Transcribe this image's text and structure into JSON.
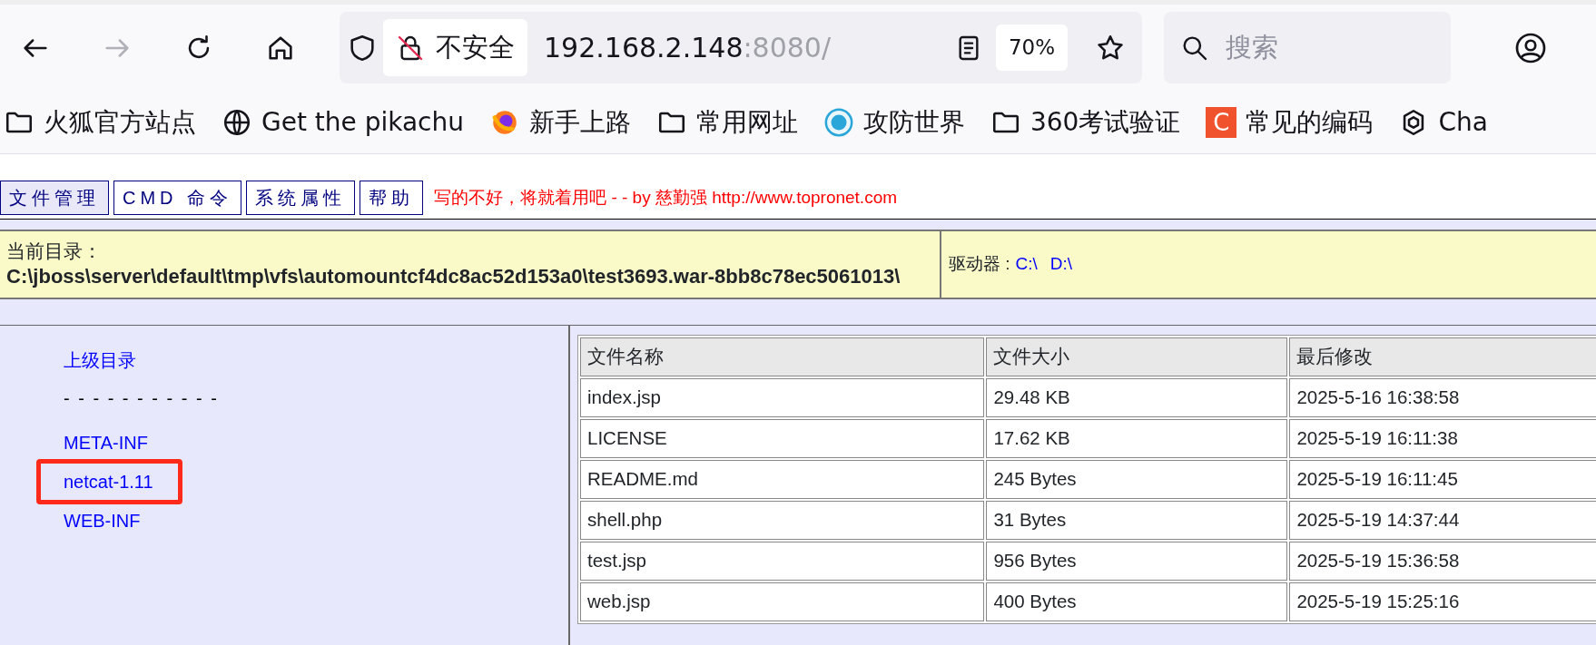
{
  "browser": {
    "forward_disabled": true,
    "security_label": "不安全",
    "host": "192.168.2.148",
    "port_path": ":8080/",
    "zoom": "70%",
    "search": {
      "placeholder": "搜索"
    }
  },
  "bookmarks": [
    {
      "kind": "folder",
      "label": "火狐官方站点"
    },
    {
      "kind": "globe",
      "label": "Get the pikachu"
    },
    {
      "kind": "fox",
      "label": "新手上路"
    },
    {
      "kind": "folder",
      "label": "常用网址"
    },
    {
      "kind": "seal",
      "label": "攻防世界"
    },
    {
      "kind": "folder",
      "label": "360考试验证"
    },
    {
      "kind": "letter",
      "icon_text": "C",
      "color": "#f0522d",
      "label": "常见的编码"
    },
    {
      "kind": "knot",
      "label": "Cha"
    }
  ],
  "tabs": [
    {
      "label": "文件管理",
      "selected": true
    },
    {
      "label": "CMD 命令",
      "selected": false
    },
    {
      "label": "系统属性",
      "selected": false
    },
    {
      "label": "帮助",
      "selected": false
    }
  ],
  "notice": "写的不好，将就着用吧 - - by 慈勤强 http://www.topronet.com",
  "current_dir": {
    "label": "当前目录：",
    "path": "C:\\jboss\\server\\default\\tmp\\vfs\\automountcf4dc8ac52d153a0\\test3693.war-8bb8c78ec5061013\\"
  },
  "drives": {
    "label": "驱动器 :",
    "items": [
      "C:\\",
      "D:\\"
    ]
  },
  "dirs": [
    {
      "kind": "link",
      "label": "上级目录",
      "highlighted": false
    },
    {
      "kind": "separator",
      "label": "- - - - - - - - - - -"
    },
    {
      "kind": "link",
      "label": "META-INF",
      "highlighted": false
    },
    {
      "kind": "link",
      "label": "netcat-1.11",
      "highlighted": true
    },
    {
      "kind": "link",
      "label": "WEB-INF",
      "highlighted": false
    }
  ],
  "table": {
    "columns": [
      "文件名称",
      "文件大小",
      "最后修改"
    ],
    "rows": [
      [
        "index.jsp",
        "29.48 KB",
        "2025-5-16 16:38:58"
      ],
      [
        "LICENSE",
        "17.62 KB",
        "2025-5-19 16:11:38"
      ],
      [
        "README.md",
        "245 Bytes",
        "2025-5-19 16:11:45"
      ],
      [
        "shell.php",
        "31 Bytes",
        "2025-5-19 14:37:44"
      ],
      [
        "test.jsp",
        "956 Bytes",
        "2025-5-19 15:36:58"
      ],
      [
        "web.jsp",
        "400 Bytes",
        "2025-5-19 15:25:16"
      ]
    ]
  }
}
